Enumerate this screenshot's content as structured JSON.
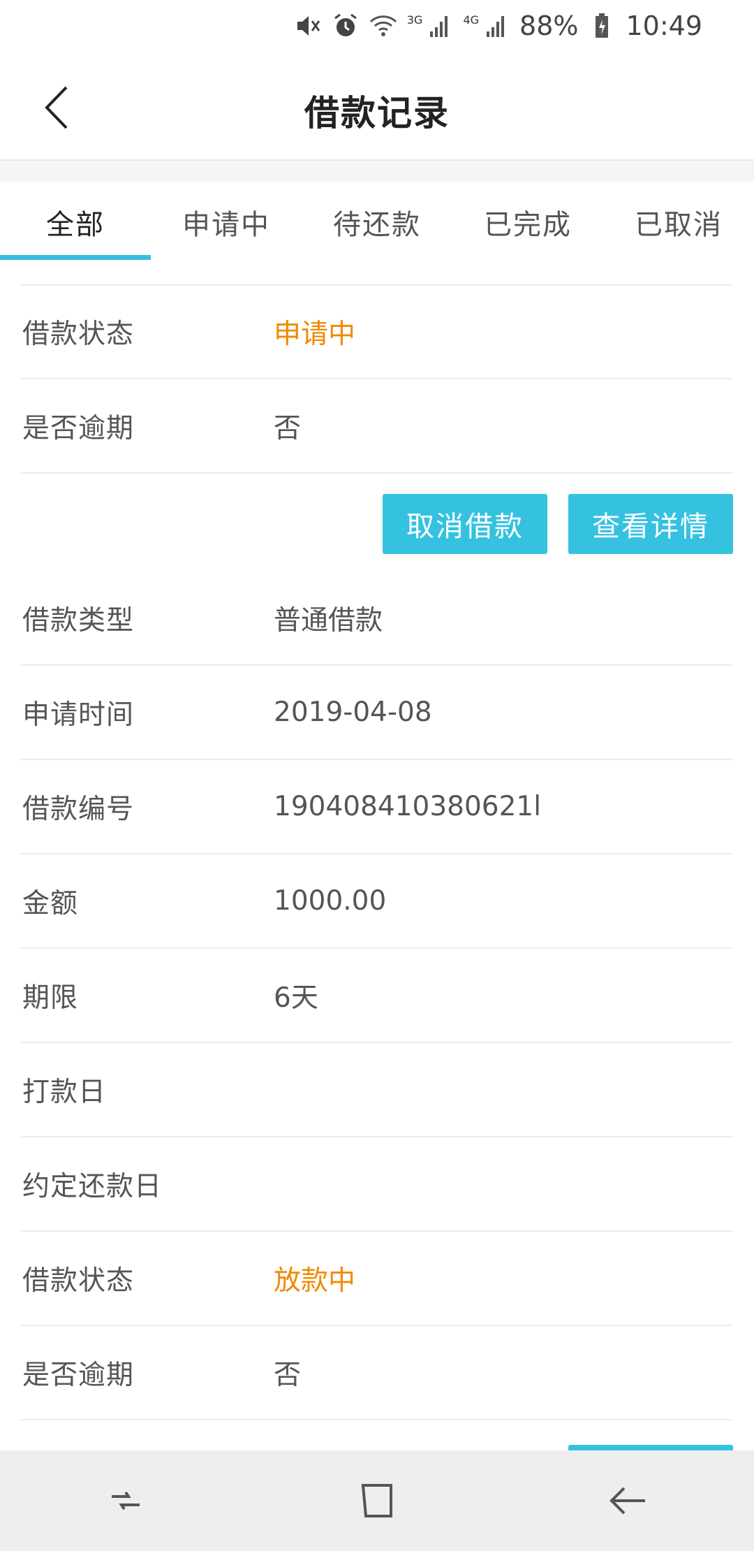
{
  "status_bar": {
    "net_3g": "3G",
    "net_4g": "4G",
    "battery": "88%",
    "time": "10:49"
  },
  "header": {
    "title": "借款记录"
  },
  "tabs": [
    {
      "label": "全部",
      "active": true
    },
    {
      "label": "申请中",
      "active": false
    },
    {
      "label": "待还款",
      "active": false
    },
    {
      "label": "已完成",
      "active": false
    },
    {
      "label": "已取消",
      "active": false
    }
  ],
  "record1": {
    "status_label": "借款状态",
    "status_value": "申请中",
    "overdue_label": "是否逾期",
    "overdue_value": "否",
    "cancel_button": "取消借款",
    "detail_button": "查看详情"
  },
  "record2": {
    "type_label": "借款类型",
    "type_value": "普通借款",
    "apply_time_label": "申请时间",
    "apply_time_value": "2019-04-08",
    "number_label": "借款编号",
    "number_value": "190408410380621l",
    "amount_label": "金额",
    "amount_value": "1000.00",
    "term_label": "期限",
    "term_value": "6天",
    "payment_day_label": "打款日",
    "payment_day_value": "",
    "due_day_label": "约定还款日",
    "due_day_value": "",
    "status_label": "借款状态",
    "status_value": "放款中",
    "overdue_label": "是否逾期",
    "overdue_value": "否"
  },
  "colors": {
    "accent": "#35c2e0",
    "status_orange": "#f08a00"
  },
  "icons": {
    "status": [
      "mute-icon",
      "alarm-icon",
      "wifi-icon",
      "signal-3g-icon",
      "signal-4g-icon",
      "battery-charging-icon"
    ],
    "header_back": "back-chevron-icon",
    "nav": [
      "recent-apps-icon",
      "home-icon",
      "back-icon"
    ]
  }
}
